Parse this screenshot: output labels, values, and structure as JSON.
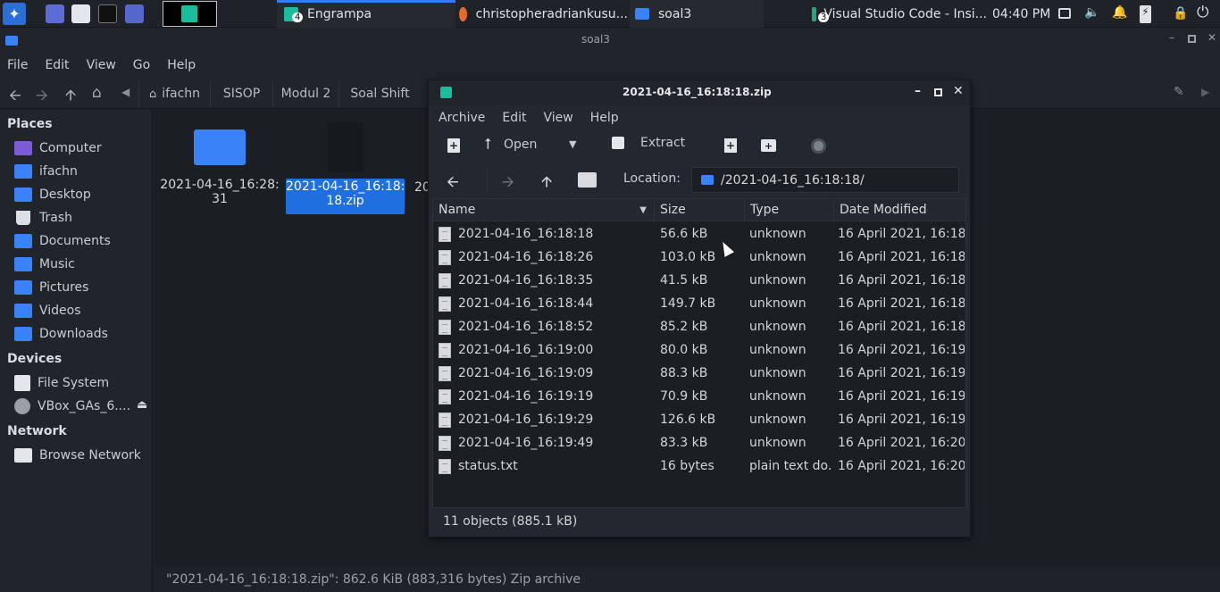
{
  "taskbar": {
    "tasks": [
      {
        "label": "Engrampa",
        "badge": "4"
      },
      {
        "label": "christopheradriankusu..."
      },
      {
        "label": "soal3"
      },
      {
        "label": "Visual Studio Code - Insi...",
        "badge": "3"
      }
    ],
    "clock": "04:40 PM"
  },
  "file_manager": {
    "title": "soal3",
    "menu": [
      "File",
      "Edit",
      "View",
      "Go",
      "Help"
    ],
    "breadcrumbs": [
      "ifachn",
      "SISOP",
      "Modul 2",
      "Soal Shift"
    ],
    "places_heading": "Places",
    "places": [
      "Computer",
      "ifachn",
      "Desktop",
      "Trash",
      "Documents",
      "Music",
      "Pictures",
      "Videos",
      "Downloads"
    ],
    "devices_heading": "Devices",
    "devices": [
      "File System",
      "VBox_GAs_6...."
    ],
    "network_heading": "Network",
    "network": [
      "Browse Network"
    ],
    "items": [
      {
        "line1": "2021-04-16_16:28:",
        "line2": "31"
      },
      {
        "line1": "2021-04-16_16:18:",
        "line2": "18.zip"
      },
      {
        "line1": "20"
      }
    ],
    "status": "\"2021-04-16_16:18:18.zip\": 862.6 KiB (883,316 bytes) Zip archive"
  },
  "archive_window": {
    "title": "2021-04-16_16:18:18.zip",
    "menu": [
      "Archive",
      "Edit",
      "View",
      "Help"
    ],
    "toolbar": {
      "open_label": "Open",
      "extract_label": "Extract"
    },
    "location_label": "Location:",
    "location_value": "/2021-04-16_16:18:18/",
    "columns": [
      "Name",
      "Size",
      "Type",
      "Date Modified"
    ],
    "rows": [
      {
        "name": "2021-04-16_16:18:18",
        "size": "56.6 kB",
        "type": "unknown",
        "date": "16 April 2021, 16:18"
      },
      {
        "name": "2021-04-16_16:18:26",
        "size": "103.0 kB",
        "type": "unknown",
        "date": "16 April 2021, 16:18"
      },
      {
        "name": "2021-04-16_16:18:35",
        "size": "41.5 kB",
        "type": "unknown",
        "date": "16 April 2021, 16:18"
      },
      {
        "name": "2021-04-16_16:18:44",
        "size": "149.7 kB",
        "type": "unknown",
        "date": "16 April 2021, 16:18"
      },
      {
        "name": "2021-04-16_16:18:52",
        "size": "85.2 kB",
        "type": "unknown",
        "date": "16 April 2021, 16:18"
      },
      {
        "name": "2021-04-16_16:19:00",
        "size": "80.0 kB",
        "type": "unknown",
        "date": "16 April 2021, 16:19"
      },
      {
        "name": "2021-04-16_16:19:09",
        "size": "88.3 kB",
        "type": "unknown",
        "date": "16 April 2021, 16:19"
      },
      {
        "name": "2021-04-16_16:19:19",
        "size": "70.9 kB",
        "type": "unknown",
        "date": "16 April 2021, 16:19"
      },
      {
        "name": "2021-04-16_16:19:29",
        "size": "126.6 kB",
        "type": "unknown",
        "date": "16 April 2021, 16:19"
      },
      {
        "name": "2021-04-16_16:19:49",
        "size": "83.3 kB",
        "type": "unknown",
        "date": "16 April 2021, 16:20"
      },
      {
        "name": "status.txt",
        "size": "16 bytes",
        "type": "plain text do...",
        "date": "16 April 2021, 16:20"
      }
    ],
    "status": "11 objects (885.1 kB)"
  },
  "colors": {
    "accent": "#2f7ff0",
    "folder": "#3a82f7",
    "selection": "#1f6fe0",
    "engrampa": "#1abc9c"
  }
}
